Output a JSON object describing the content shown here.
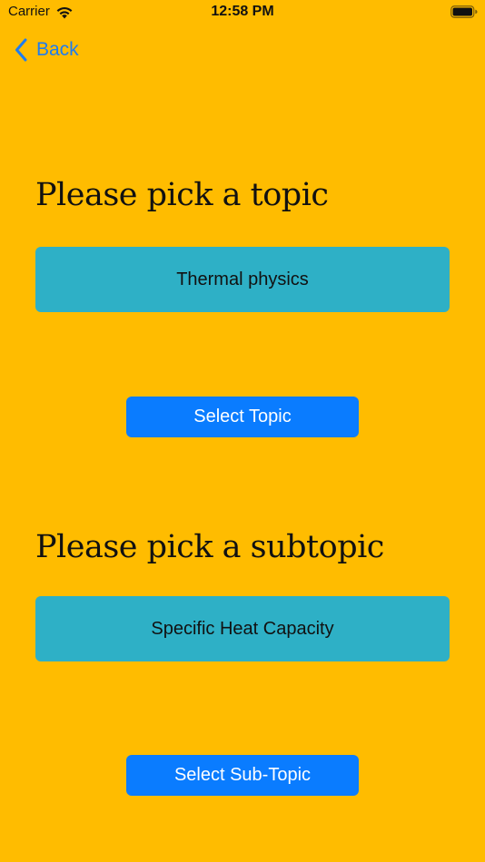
{
  "status_bar": {
    "carrier": "Carrier",
    "time": "12:58 PM"
  },
  "nav": {
    "back_label": "Back"
  },
  "topic_section": {
    "heading": "Please pick a topic",
    "selected_value": "Thermal physics",
    "button_label": "Select Topic"
  },
  "subtopic_section": {
    "heading": "Please pick a subtopic",
    "selected_value": "Specific Heat Capacity",
    "button_label": "Select Sub-Topic"
  },
  "colors": {
    "background": "#FFBC00",
    "picker": "#2EB0C6",
    "button": "#0A7CFF",
    "link": "#1E7CF0"
  },
  "icons": [
    "wifi-icon",
    "battery-icon",
    "chevron-left-icon"
  ]
}
